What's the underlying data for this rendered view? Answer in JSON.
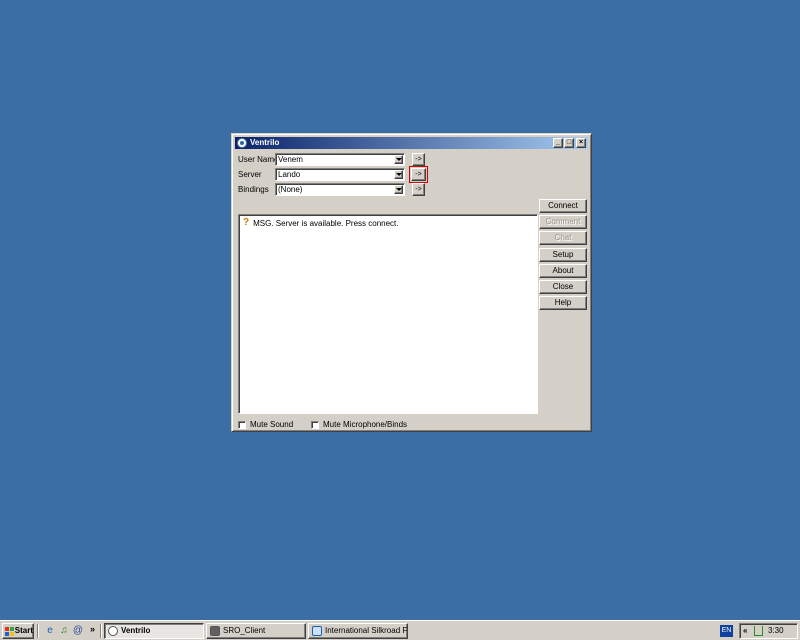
{
  "window": {
    "title": "Ventrilo",
    "buttons": {
      "minimize": "_",
      "maximize": "□",
      "close": "×"
    }
  },
  "form": {
    "user_name_label": "User Name",
    "user_name_value": "Venem",
    "server_label": "Server",
    "server_value": "Lando",
    "bindings_label": "Bindings",
    "bindings_value": "(None)",
    "arrow_button": "->"
  },
  "log": {
    "messages": [
      "MSG. Server is available. Press connect."
    ]
  },
  "side_buttons": {
    "connect": "Connect",
    "comment": "Comment",
    "chat": "Chat",
    "setup": "Setup",
    "about": "About",
    "close": "Close",
    "help": "Help"
  },
  "checkboxes": {
    "mute_sound": "Mute Sound",
    "mute_microphone": "Mute Microphone/Binds"
  },
  "taskbar": {
    "start": "Start",
    "quick_launch_more": "»",
    "tasks": [
      "Ventrilo",
      "SRO_Client",
      "International Silkroad Fo..."
    ],
    "language": "EN",
    "tray_more": "«",
    "clock": "3:30 PM"
  },
  "colors": {
    "desktop": "#3a6ea5",
    "title_gradient_start": "#0a246a",
    "title_gradient_end": "#a6caf0",
    "face": "#d4d0c8",
    "focus_highlight": "#d00000"
  }
}
